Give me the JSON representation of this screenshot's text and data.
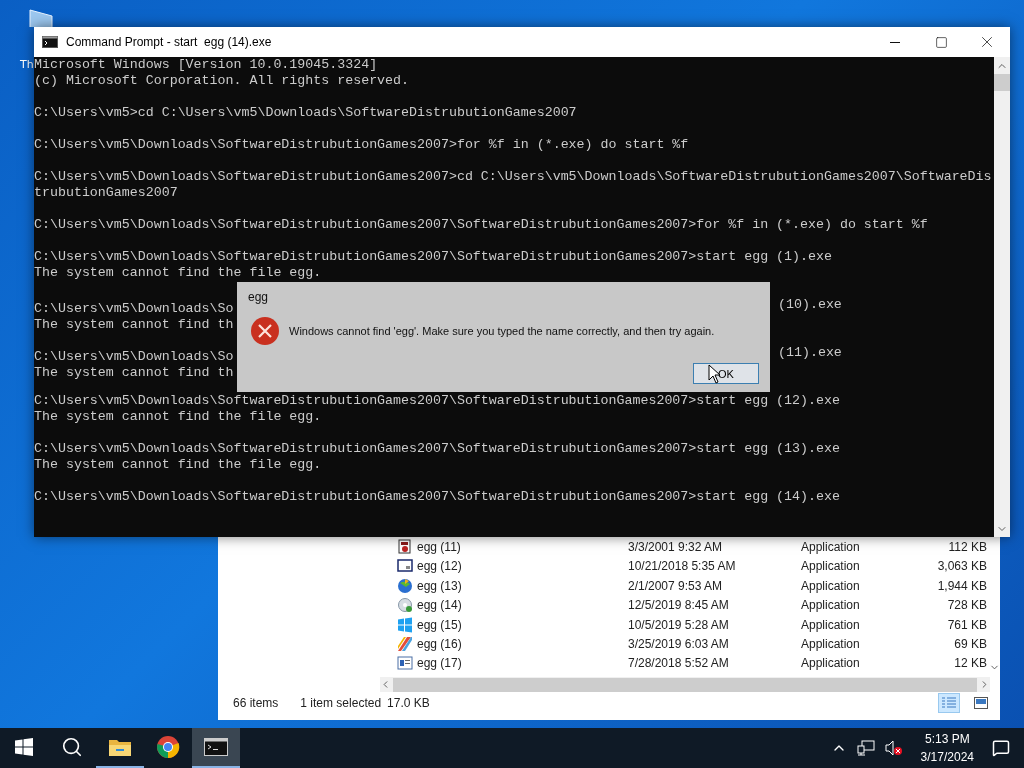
{
  "desktop": {
    "icon_label": "Th"
  },
  "console_window": {
    "title": "Command Prompt - start  egg (14).exe",
    "blocks": [
      [
        "Microsoft Windows [Version 10.0.19045.3324]",
        "(c) Microsoft Corporation. All rights reserved."
      ],
      [
        "C:\\Users\\vm5>cd C:\\Users\\vm5\\Downloads\\SoftwareDistrubutionGames2007"
      ],
      [
        "C:\\Users\\vm5\\Downloads\\SoftwareDistrubutionGames2007>for %f in (*.exe) do start %f"
      ],
      [
        "C:\\Users\\vm5\\Downloads\\SoftwareDistrubutionGames2007>cd C:\\Users\\vm5\\Downloads\\SoftwareDistrubutionGames2007\\SoftwareDis",
        "trubutionGames2007"
      ],
      [
        "C:\\Users\\vm5\\Downloads\\SoftwareDistrubutionGames2007\\SoftwareDistrubutionGames2007>for %f in (*.exe) do start %f"
      ],
      [
        "C:\\Users\\vm5\\Downloads\\SoftwareDistrubutionGames2007\\SoftwareDistrubutionGames2007>start egg (1).exe",
        "The system cannot find the file egg."
      ],
      [
        {
          "left": "C:\\Users\\vm5\\Downloads\\So",
          "right": "(10).exe"
        },
        {
          "left": "The system cannot find th"
        }
      ],
      [
        {
          "left": "C:\\Users\\vm5\\Downloads\\So",
          "right": "(11).exe"
        },
        {
          "left": "The system cannot find th"
        }
      ],
      [
        "C:\\Users\\vm5\\Downloads\\SoftwareDistrubutionGames2007\\SoftwareDistrubutionGames2007>start egg (12).exe",
        "The system cannot find the file egg."
      ],
      [
        "C:\\Users\\vm5\\Downloads\\SoftwareDistrubutionGames2007\\SoftwareDistrubutionGames2007>start egg (13).exe",
        "The system cannot find the file egg."
      ],
      [
        "C:\\Users\\vm5\\Downloads\\SoftwareDistrubutionGames2007\\SoftwareDistrubutionGames2007>start egg (14).exe"
      ]
    ]
  },
  "dialog": {
    "title": "egg",
    "message": "Windows cannot find 'egg'. Make sure you typed the name correctly, and then try again.",
    "button": "OK"
  },
  "explorer": {
    "rows": [
      {
        "kind": "puzzle",
        "name": "egg (11)",
        "date": "3/3/2001 9:32 AM",
        "type": "Application",
        "size": "112 KB"
      },
      {
        "kind": "window",
        "name": "egg (12)",
        "date": "10/21/2018 5:35 AM",
        "type": "Application",
        "size": "3,063 KB"
      },
      {
        "kind": "globe",
        "name": "egg (13)",
        "date": "2/1/2007 9:53 AM",
        "type": "Application",
        "size": "1,944 KB"
      },
      {
        "kind": "disc",
        "name": "egg (14)",
        "date": "12/5/2019 8:45 AM",
        "type": "Application",
        "size": "728 KB"
      },
      {
        "kind": "tiles",
        "name": "egg (15)",
        "date": "10/5/2019 5:28 AM",
        "type": "Application",
        "size": "761 KB"
      },
      {
        "kind": "stripes",
        "name": "egg (16)",
        "date": "3/25/2019 6:03 AM",
        "type": "Application",
        "size": "69 KB"
      },
      {
        "kind": "form",
        "name": "egg (17)",
        "date": "7/28/2018 5:52 AM",
        "type": "Application",
        "size": "12 KB"
      }
    ],
    "status": {
      "count": "66 items",
      "selection": "1 item selected",
      "size": "17.0 KB"
    }
  },
  "taskbar": {
    "apps": [
      {
        "kind": "explorer",
        "running": true,
        "selected": false
      },
      {
        "kind": "chrome",
        "running": false,
        "selected": false
      },
      {
        "kind": "console",
        "running": true,
        "selected": true
      }
    ],
    "time": "5:13 PM",
    "date": "3/17/2024"
  }
}
